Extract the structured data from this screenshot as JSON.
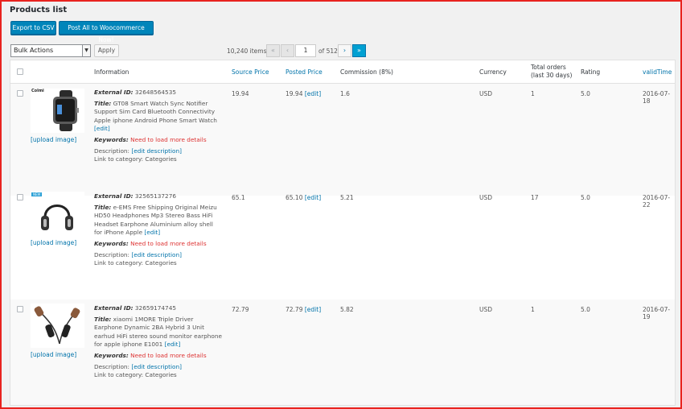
{
  "page": {
    "title": "Products list"
  },
  "toolbar": {
    "export_label": "Export to CSV",
    "post_all_label": "Post All to Woocommerce Now!"
  },
  "bulk": {
    "selected": "Bulk Actions",
    "apply_label": "Apply"
  },
  "pagination": {
    "items": "10,240 items",
    "first": "«",
    "prev": "‹",
    "current_page": "1",
    "of_pages": "of 512",
    "next": "›",
    "last": "»"
  },
  "columns": {
    "information": "Information",
    "source_price": "Source Price",
    "posted_price": "Posted Price",
    "commission": "Commission (8%)",
    "currency": "Currency",
    "total_orders_1": "Total orders",
    "total_orders_2": "(last 30 days)",
    "rating": "Rating",
    "valid_time": "validTime"
  },
  "labels": {
    "external_id": "External ID:",
    "title": "Title:",
    "keywords": "Keywords:",
    "need_more": "Need to load more details",
    "description": "Description:",
    "edit_description": "[edit description]",
    "link_to_category": "Link to category: Categories",
    "edit": "[edit]",
    "upload_image": "[upload image]"
  },
  "rows": [
    {
      "thumb_text": "Colmi",
      "external_id": "32648564535",
      "title": "GT08 Smart Watch Sync Notifier Support Sim Card Bluetooth Connectivity Apple iphone Android Phone Smart Watch",
      "source_price": "19.94",
      "posted_price": "19.94",
      "commission": "1.6",
      "currency": "USD",
      "total_orders": "1",
      "rating": "5.0",
      "valid_time": "2016-07-18"
    },
    {
      "thumb_text": "NEW",
      "external_id": "32565137276",
      "title": "e-EMS Free Shipping Original Meizu HD50 Headphones Mp3 Stereo Bass HiFi Headset Earphone Aluminium alloy shell for iPhone Apple",
      "source_price": "65.1",
      "posted_price": "65.10",
      "commission": "5.21",
      "currency": "USD",
      "total_orders": "17",
      "rating": "5.0",
      "valid_time": "2016-07-22"
    },
    {
      "thumb_text": "",
      "external_id": "32659174745",
      "title": "xiaomi 1MORE Triple Driver Earphone Dynamic 2BA Hybrid 3 Unit earhud HiFi stereo sound monitor earphone for apple iphone E1001",
      "source_price": "72.79",
      "posted_price": "72.79",
      "commission": "5.82",
      "currency": "USD",
      "total_orders": "1",
      "rating": "5.0",
      "valid_time": "2016-07-19"
    }
  ],
  "colors": {
    "accent": "#0085ba",
    "link": "#0073aa",
    "warning": "#dd3232",
    "frame": "#e8231f"
  },
  "icons": {
    "watch": "smartwatch-icon",
    "headphones": "headphones-icon",
    "earphones": "earphones-icon"
  }
}
